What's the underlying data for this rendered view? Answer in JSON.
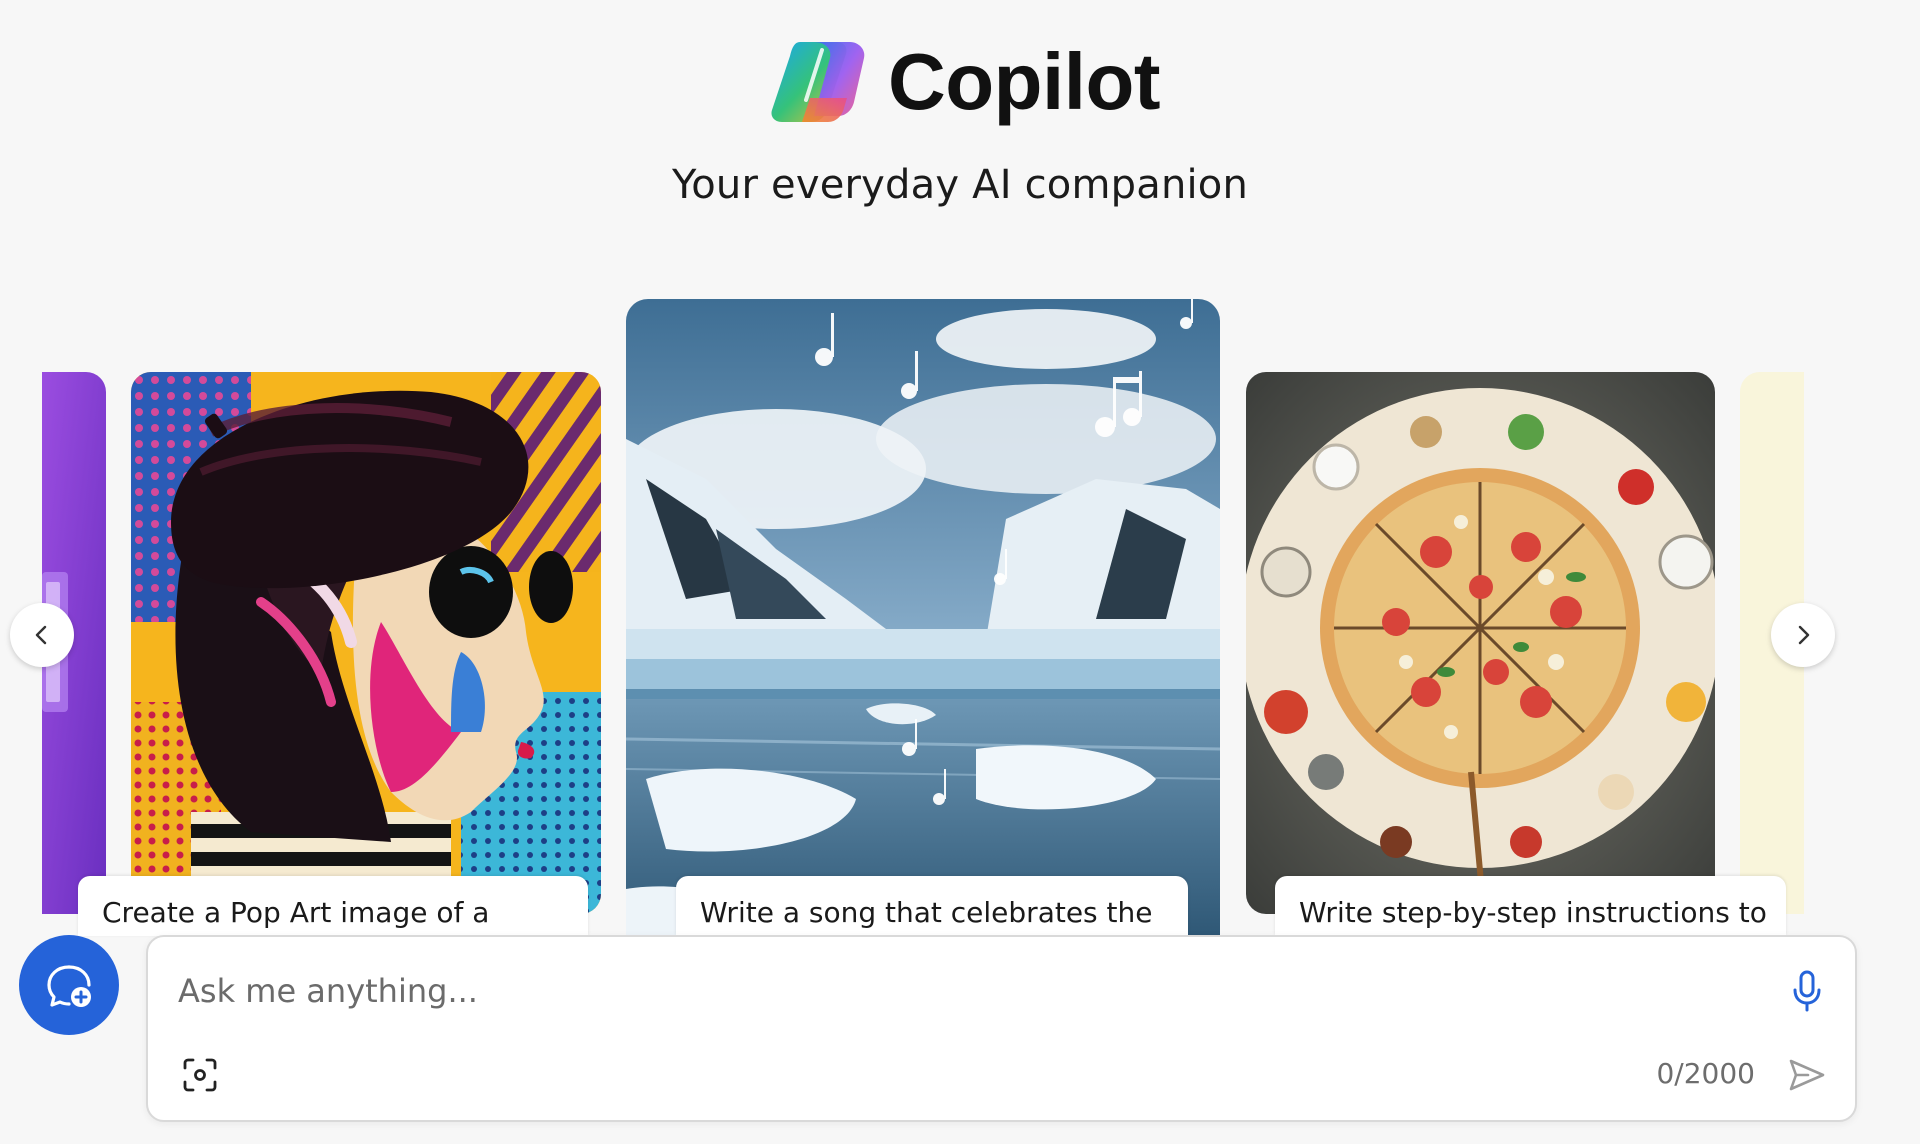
{
  "header": {
    "brand_name": "Copilot",
    "tagline": "Your everyday AI companion"
  },
  "carousel": {
    "cards": [
      {
        "caption": "Create a Pop Art image of a",
        "image": "pop-art-woman-beret-sunglasses"
      },
      {
        "caption": "Write a song that celebrates the",
        "image": "arctic-glacier-music-notes"
      },
      {
        "caption": "Write step-by-step instructions to",
        "image": "pizza-infographic"
      }
    ],
    "prev_icon": "chevron-left-icon",
    "next_icon": "chevron-right-icon"
  },
  "composer": {
    "placeholder": "Ask me anything...",
    "char_count": "0/2000",
    "icons": [
      "new-topic-icon",
      "microphone-icon",
      "visual-search-icon",
      "send-icon"
    ]
  },
  "colors": {
    "accent": "#2563d9",
    "background": "#f7f7f7"
  }
}
